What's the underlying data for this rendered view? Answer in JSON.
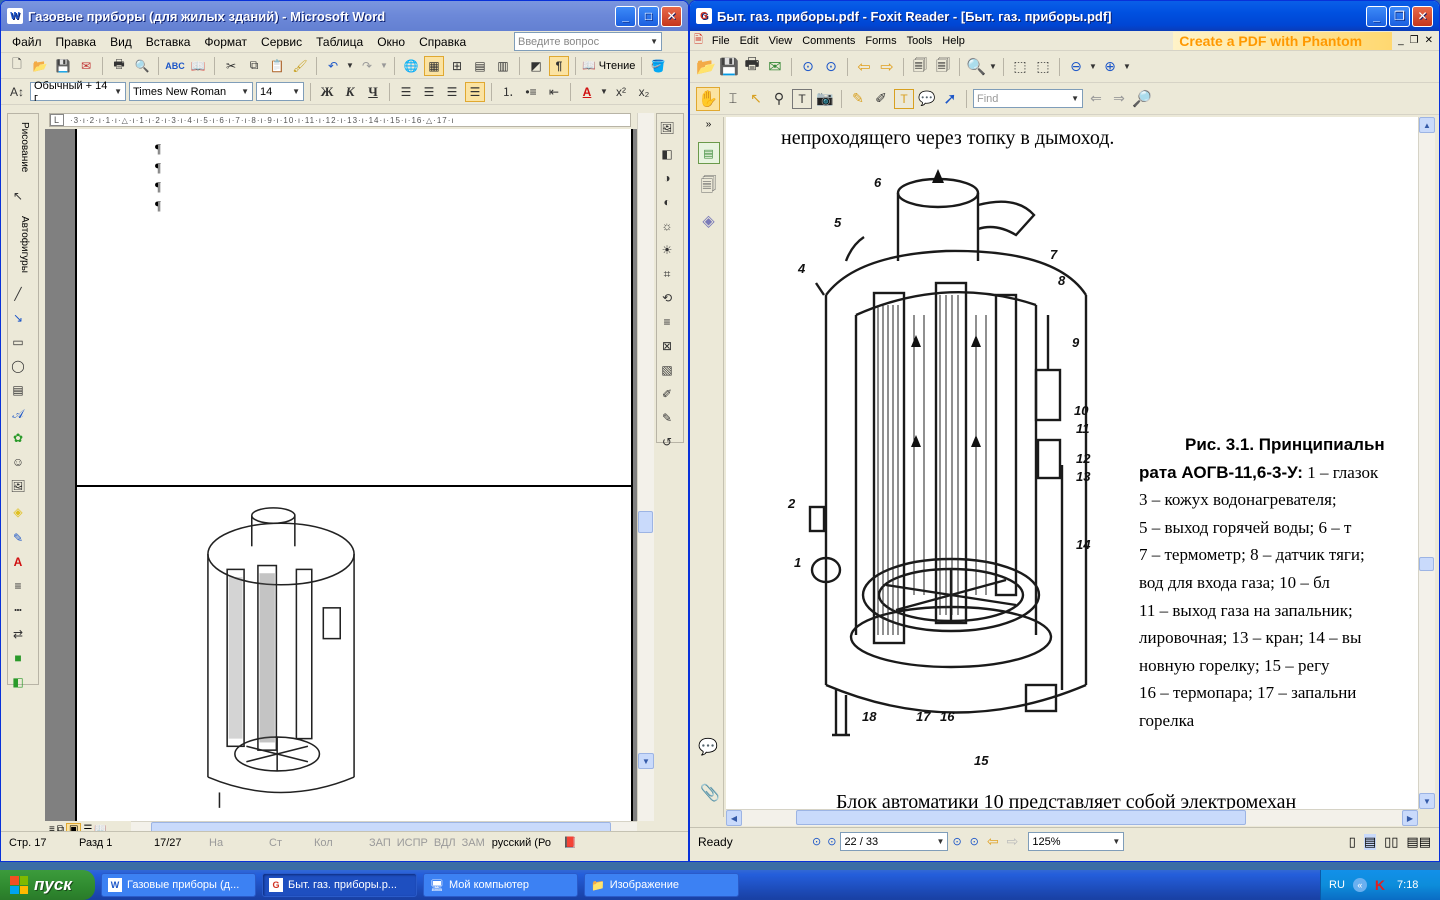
{
  "word": {
    "title": "Газовые приборы (для жилых зданий) - Microsoft Word",
    "menu": [
      "Файл",
      "Правка",
      "Вид",
      "Вставка",
      "Формат",
      "Сервис",
      "Таблица",
      "Окно",
      "Справка"
    ],
    "help_placeholder": "Введите вопрос",
    "reading_label": "Чтение",
    "style_value": "Обычный + 14 г",
    "font_value": "Times New Roman",
    "size_value": "14",
    "format_buttons": [
      "Ж",
      "К",
      "Ч"
    ],
    "drawing_label": "Рисование",
    "autoshapes_label": "Автофигуры",
    "pilcrow": "¶",
    "status": {
      "page": "Стр.  17",
      "section": "Разд  1",
      "pages": "17/27",
      "at": "На",
      "line": "Ст",
      "col": "Кол",
      "rec": "ЗАП",
      "trk": "ИСПР",
      "ext": "ВДЛ",
      "ovr": "ЗАМ",
      "lang": "русский (Ро"
    }
  },
  "foxit": {
    "title": "Быт. газ. приборы.pdf - Foxit Reader - [Быт. газ. приборы.pdf]",
    "menu": [
      "File",
      "Edit",
      "View",
      "Comments",
      "Forms",
      "Tools",
      "Help"
    ],
    "promo": "Create a PDF with Phantom",
    "find_placeholder": "Find",
    "text_top": "непроходящего через топку в дымоход.",
    "caption_lines": [
      {
        "bold": "Рис.   3.1.  Принципиальн",
        "rest": ""
      },
      {
        "bold": "рата АОГВ-11,6-3-У:",
        "rest": " 1 – глазок"
      },
      {
        "bold": "",
        "rest": "3  –  кожух  водонагревателя;"
      },
      {
        "bold": "",
        "rest": "5 – выход горячей воды; 6 – т"
      },
      {
        "bold": "",
        "rest": "7 – термометр; 8 – датчик тяги;"
      },
      {
        "bold": "",
        "rest": "вод  для  входа  газа;  10  –  бл"
      },
      {
        "bold": "",
        "rest": "11 – выход газа на запальник;"
      },
      {
        "bold": "",
        "rest": "лировочная; 13 – кран; 14 – вы"
      },
      {
        "bold": "",
        "rest": "новную  горелку;  15  –  регу"
      },
      {
        "bold": "",
        "rest": "16 – термопара; 17 – запальни"
      },
      {
        "bold": "",
        "rest": "горелка"
      }
    ],
    "text_bottom": "Блок  автоматики  10  представляет  собой  электромехан",
    "figure_labels": [
      "1",
      "2",
      "4",
      "5",
      "6",
      "7",
      "8",
      "9",
      "10",
      "11",
      "12",
      "13",
      "14",
      "15",
      "16",
      "17",
      "18"
    ],
    "status": {
      "ready": "Ready",
      "page": "22 / 33",
      "zoom": "125%"
    }
  },
  "taskbar": {
    "start": "пуск",
    "tasks": [
      {
        "label": "Газовые приборы (д...",
        "active": false
      },
      {
        "label": "Быт. газ. приборы.p...",
        "active": true
      },
      {
        "label": "Мой компьютер",
        "active": false
      },
      {
        "label": "Изображение",
        "active": false
      }
    ],
    "lang": "RU",
    "time": "7:18"
  },
  "colors": {
    "xp_blue": "#0050e0",
    "start_green": "#2f8a2f",
    "promo_orange": "#ff9900"
  }
}
